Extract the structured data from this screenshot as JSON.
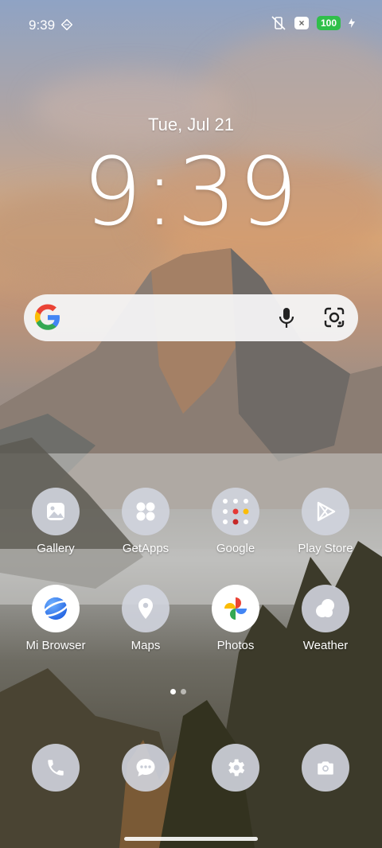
{
  "status_bar": {
    "time": "9:39",
    "battery": "100"
  },
  "lockscreen": {
    "date": "Tue, Jul 21",
    "clock": "9:39"
  },
  "search_bar": {
    "logo_icon": "google-g-icon",
    "mic_icon": "mic-icon",
    "lens_icon": "google-lens-icon"
  },
  "apps": [
    {
      "label": "Gallery",
      "icon": "gallery-icon"
    },
    {
      "label": "GetApps",
      "icon": "getapps-icon"
    },
    {
      "label": "Google",
      "icon": "google-folder-icon"
    },
    {
      "label": "Play Store",
      "icon": "play-store-icon"
    },
    {
      "label": "Mi Browser",
      "icon": "browser-icon"
    },
    {
      "label": "Maps",
      "icon": "maps-icon"
    },
    {
      "label": "Photos",
      "icon": "photos-icon"
    },
    {
      "label": "Weather",
      "icon": "weather-icon"
    }
  ],
  "dock": [
    {
      "icon": "phone-icon"
    },
    {
      "icon": "messages-icon"
    },
    {
      "icon": "settings-icon"
    },
    {
      "icon": "camera-icon"
    }
  ],
  "page_indicator": {
    "pages": 2,
    "current": 1
  }
}
